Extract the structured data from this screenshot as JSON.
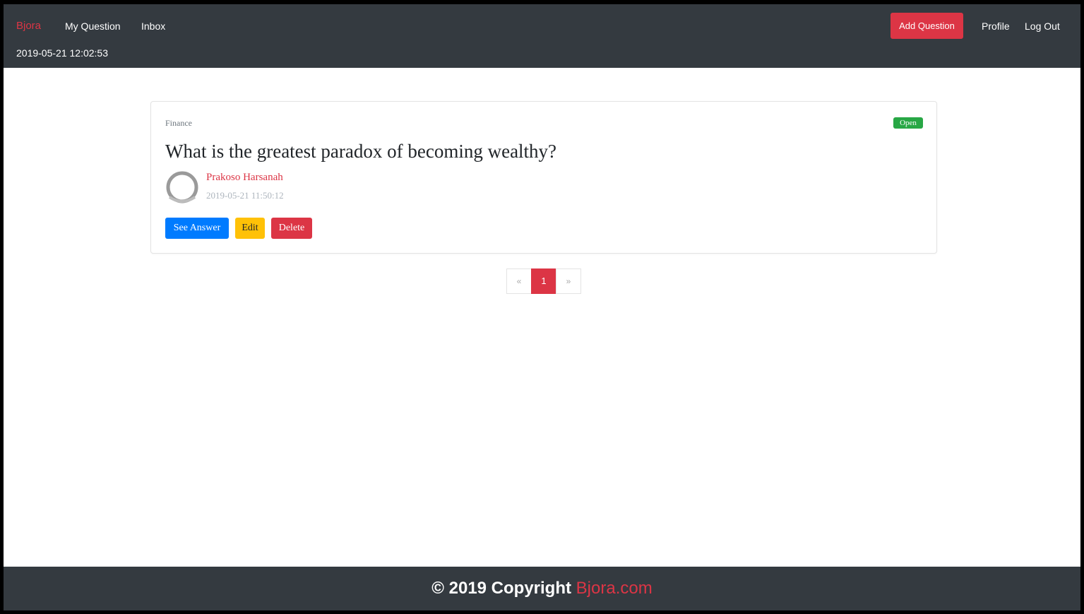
{
  "navbar": {
    "brand": "Bjora",
    "links": {
      "my_question": "My Question",
      "inbox": "Inbox",
      "profile": "Profile",
      "logout": "Log Out"
    },
    "datetime": "2019-05-21 12:02:53",
    "add_question_label": "Add Question"
  },
  "question": {
    "category": "Finance",
    "status": "Open",
    "title": "What is the greatest paradox of becoming wealthy?",
    "author": "Prakoso Harsanah",
    "date": "2019-05-21 11:50:12",
    "buttons": {
      "see_answer": "See Answer",
      "edit": "Edit",
      "delete": "Delete"
    }
  },
  "pagination": {
    "prev": "«",
    "current": "1",
    "next": "»"
  },
  "footer": {
    "copyright": "© 2019 Copyright ",
    "site": "Bjora.com"
  },
  "colors": {
    "navbar_bg": "#343a40",
    "accent": "#dc3545",
    "primary": "#007bff",
    "warning": "#ffc107",
    "success": "#28a745"
  }
}
